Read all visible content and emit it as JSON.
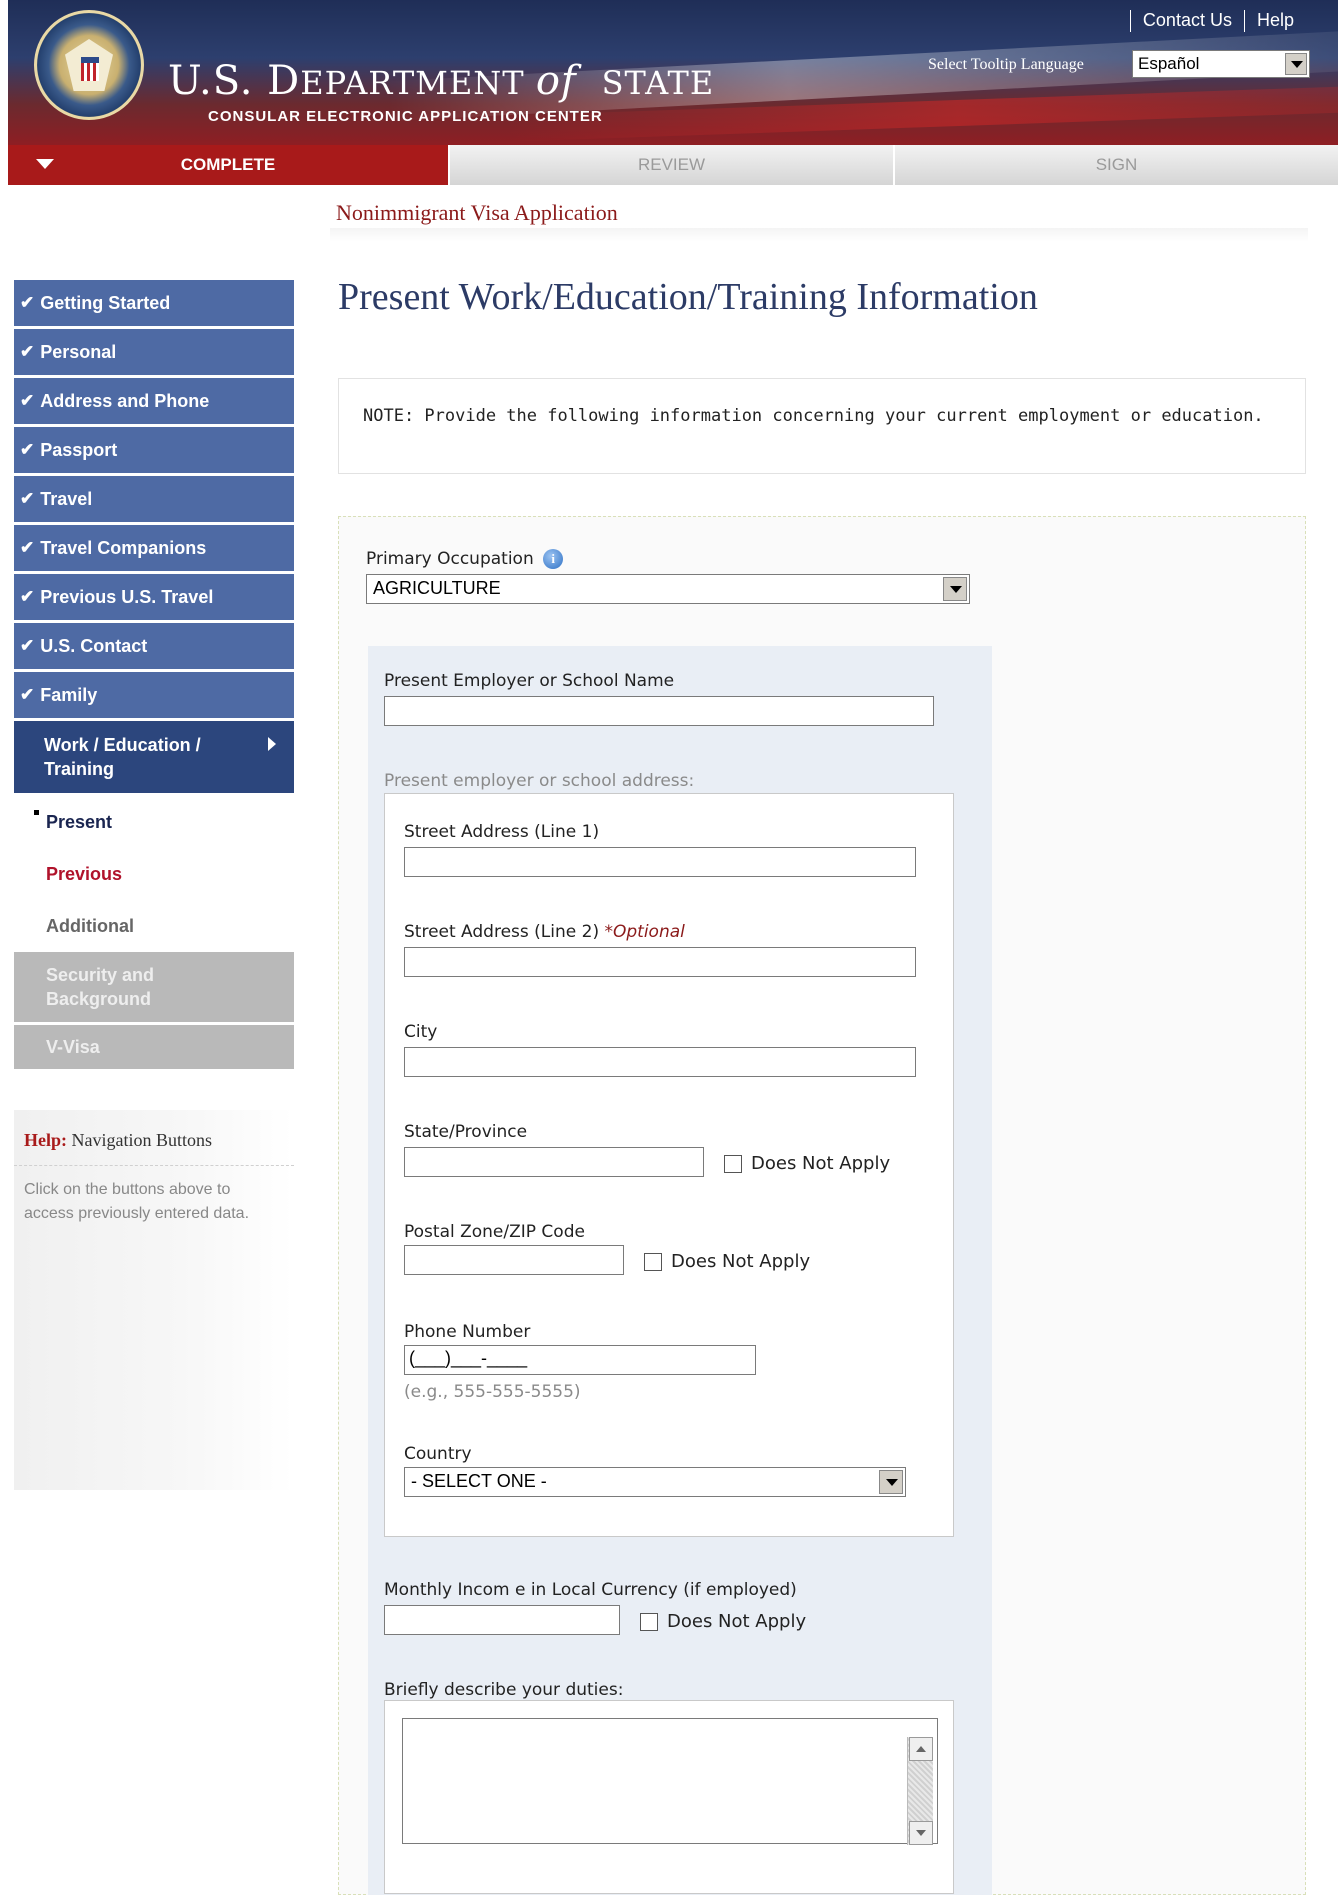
{
  "header": {
    "dept_name_pre": "U.S. D",
    "dept_name_mid": "EPARTMENT ",
    "dept_name_of": "of",
    "dept_name_post": " STATE",
    "sub_title": "CONSULAR ELECTRONIC APPLICATION CENTER",
    "contact_us": "Contact Us",
    "help": "Help",
    "tooltip_lang_label": "Select Tooltip Language",
    "tooltip_lang_value": "Español"
  },
  "steps": {
    "complete": "COMPLETE",
    "review": "REVIEW",
    "sign": "SIGN"
  },
  "breadcrumb": "Nonimmigrant Visa Application",
  "page_title": "Present Work/Education/Training Information",
  "note": "NOTE: Provide the following information concerning your current employment or education.",
  "sidebar": {
    "items": [
      {
        "label": "Getting Started"
      },
      {
        "label": "Personal"
      },
      {
        "label": "Address and Phone"
      },
      {
        "label": "Passport"
      },
      {
        "label": "Travel"
      },
      {
        "label": "Travel Companions"
      },
      {
        "label": "Previous U.S. Travel"
      },
      {
        "label": "U.S. Contact"
      },
      {
        "label": "Family"
      }
    ],
    "current_line1": "Work / Education /",
    "current_line2": "Training",
    "sub_present": "Present",
    "sub_previous": "Previous",
    "sub_additional": "Additional",
    "disabled_security_1": "Security and",
    "disabled_security_2": "Background",
    "disabled_vvisa": "V-Visa"
  },
  "help": {
    "title_bold": "Help:",
    "title_rest": " Navigation Buttons",
    "text": "Click on the buttons above to access previously entered data."
  },
  "form": {
    "primary_occupation_label": "Primary Occupation",
    "primary_occupation_value": "AGRICULTURE",
    "employer_name_label": "Present Employer or School Name",
    "employer_address_label": "Present employer or school address:",
    "street1_label": "Street Address (Line 1)",
    "street2_label": "Street Address (Line 2) ",
    "optional_marker": "*Optional",
    "city_label": "City",
    "state_label": "State/Province",
    "does_not_apply": "Does Not Apply",
    "postal_label": "Postal Zone/ZIP Code",
    "phone_label": "Phone Number",
    "phone_value": "(___)___-____",
    "phone_example": "(e.g., 555-555-5555)",
    "country_label": "Country",
    "country_value": "- SELECT ONE -",
    "monthly_income_label": "Monthly Incom e in Local Currency (if employed)",
    "duties_label": "Briefly describe your duties:"
  }
}
